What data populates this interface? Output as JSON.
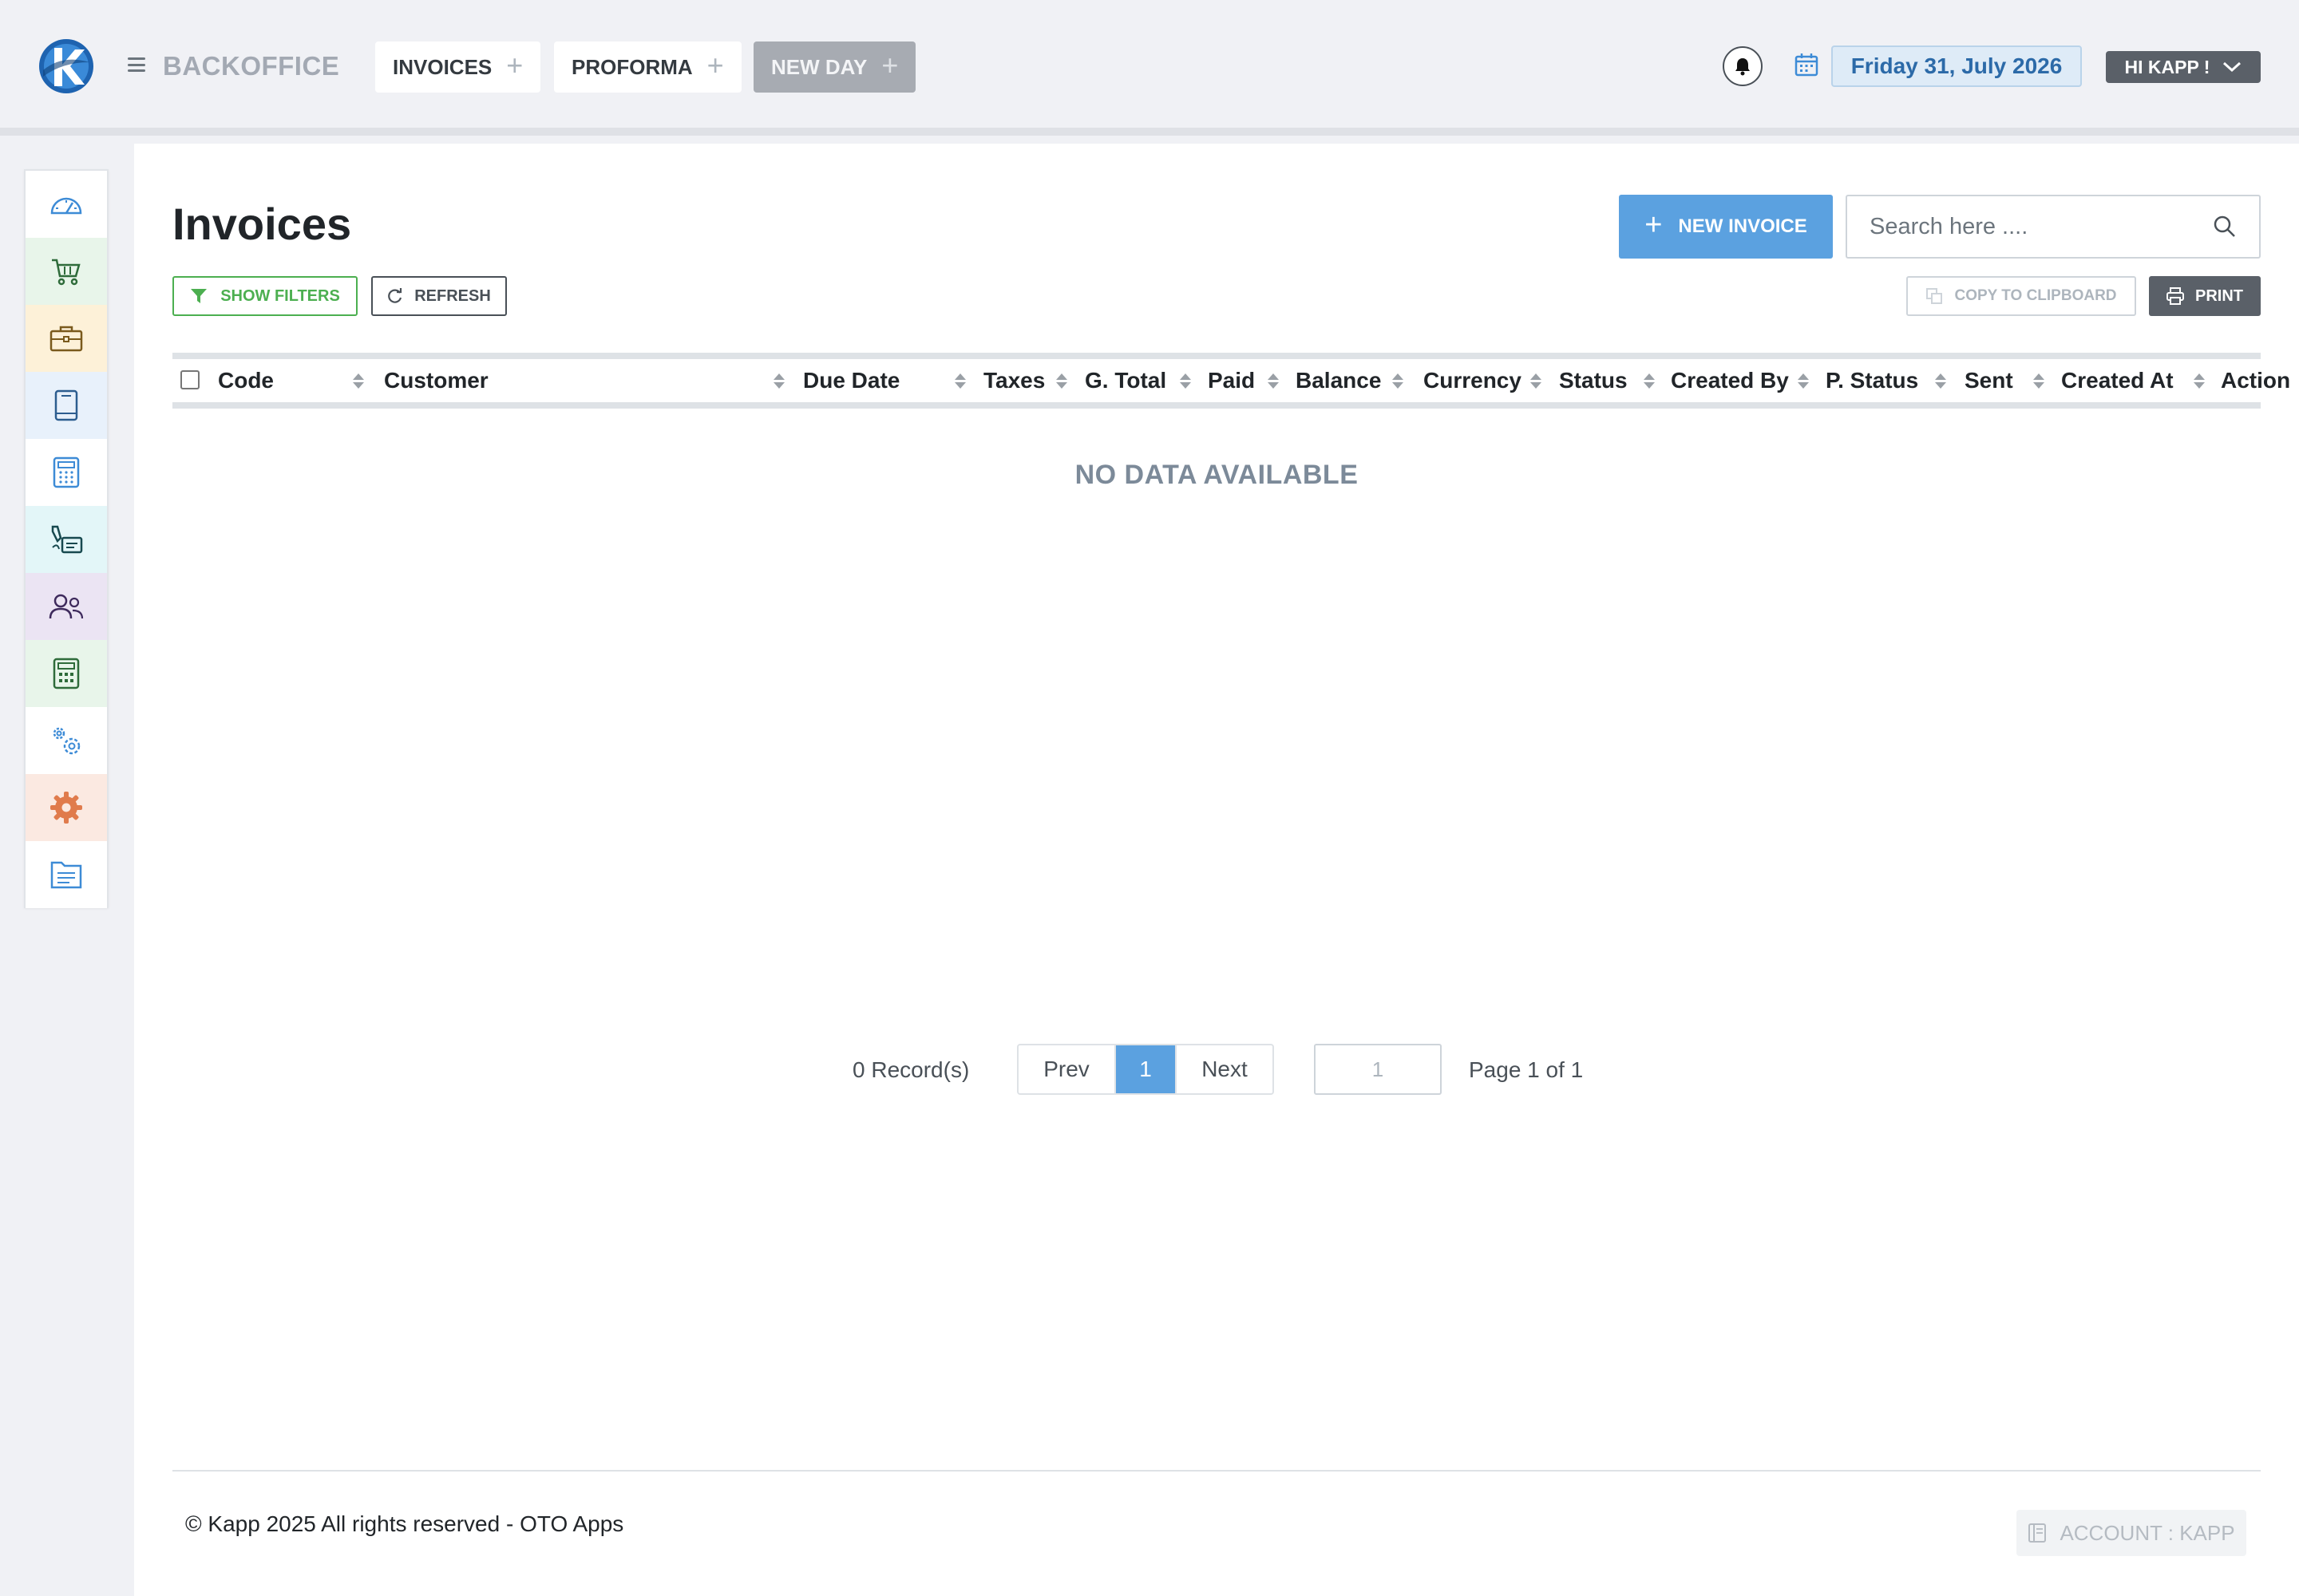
{
  "header": {
    "brand": "BACKOFFICE",
    "tabs": [
      {
        "label": "INVOICES"
      },
      {
        "label": "PROFORMA"
      },
      {
        "label": "NEW DAY"
      }
    ],
    "date": "Friday 31, July 2026",
    "user_label": "HI KAPP !"
  },
  "sidebar": {
    "items": [
      {
        "icon": "dashboard-gauge-icon",
        "bg": "#ffffff"
      },
      {
        "icon": "shopping-cart-icon",
        "bg": "#e8f5ea"
      },
      {
        "icon": "briefcase-icon",
        "bg": "#fdf1d8"
      },
      {
        "icon": "book-icon",
        "bg": "#e8f1fb"
      },
      {
        "icon": "calculator-icon",
        "bg": "#ffffff"
      },
      {
        "icon": "signature-icon",
        "bg": "#e3f6f8"
      },
      {
        "icon": "users-icon",
        "bg": "#ebe4f3"
      },
      {
        "icon": "accounting-calculator-icon",
        "bg": "#e8f5ea"
      },
      {
        "icon": "gears-icon",
        "bg": "#ffffff"
      },
      {
        "icon": "settings-gear-icon",
        "bg": "#fbe9e1"
      },
      {
        "icon": "document-icon",
        "bg": "#ffffff"
      }
    ]
  },
  "main": {
    "title": "Invoices",
    "new_button": "NEW INVOICE",
    "search_placeholder": "Search here ....",
    "show_filters": "SHOW FILTERS",
    "refresh": "REFRESH",
    "copy_clipboard": "COPY TO CLIPBOARD",
    "print": "PRINT",
    "table": {
      "columns": [
        "Code",
        "Customer",
        "Due Date",
        "Taxes",
        "G. Total",
        "Paid",
        "Balance",
        "Currency",
        "Status",
        "Created By",
        "P. Status",
        "Sent",
        "Created At",
        "Action"
      ],
      "empty_text": "NO DATA AVAILABLE"
    },
    "pagination": {
      "records": "0 Record(s)",
      "prev": "Prev",
      "current": "1",
      "next": "Next",
      "page_input": "1",
      "page_of": "Page 1 of 1"
    }
  },
  "footer": {
    "copyright": "© Kapp 2025 All rights reserved - OTO Apps",
    "account": "ACCOUNT : KAPP"
  },
  "colors": {
    "primary": "#5ba1e0",
    "success": "#4caf50",
    "dark_button": "#5a6068",
    "date_text": "#2c6aa8"
  }
}
